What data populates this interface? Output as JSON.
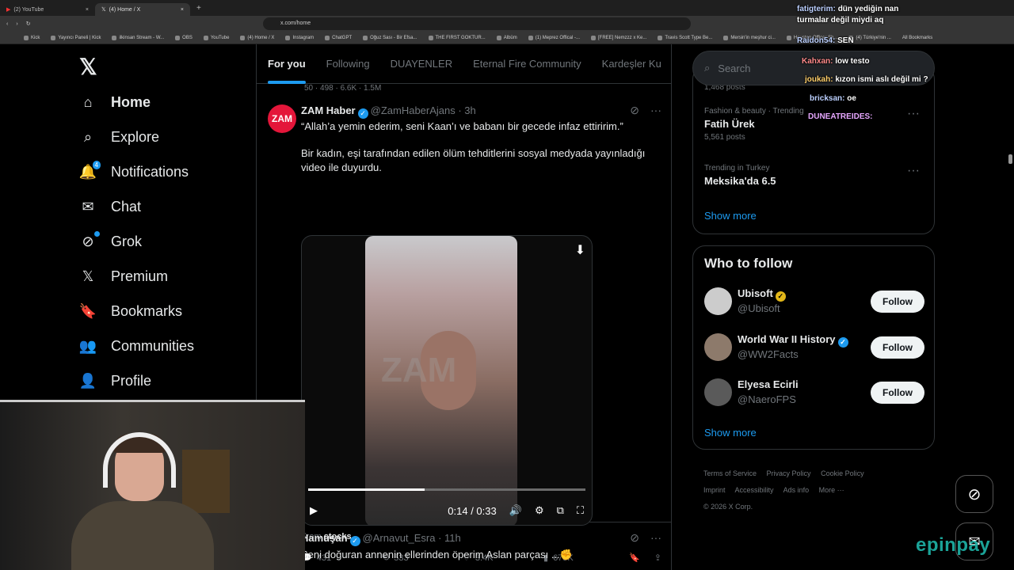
{
  "browser": {
    "tabs": [
      {
        "label": "(2) YouTube",
        "close": "×"
      },
      {
        "label": "(4) Home / X",
        "close": "×"
      }
    ],
    "new_tab": "+",
    "url": "x.com/home",
    "bookmarks": [
      "Kick",
      "Yayıncı Paneli | Kick",
      "ilkinsan Stream - W...",
      "OBS",
      "YouTube",
      "(4) Home / X",
      "Instagram",
      "ChatGPT",
      "Oğuz Sası - Bir Efsa...",
      "THE FIRST GOKTUR...",
      "Albüm",
      "(1) Meprez Offical -...",
      "[FREE] Nemzzz x Ke...",
      "Travis Scott Type Be...",
      "Mersin'in meşhur ci...",
      "Houston Officer Sh...",
      "(4) Türkiye'nin ..."
    ],
    "all_bookmarks": "All Bookmarks"
  },
  "nav": {
    "logo": "𝕏",
    "items": [
      {
        "label": "Home",
        "icon": "home-icon",
        "glyph": "⌂"
      },
      {
        "label": "Explore",
        "icon": "search-icon",
        "glyph": "⌕"
      },
      {
        "label": "Notifications",
        "icon": "bell-icon",
        "glyph": "🔔",
        "badge": "4"
      },
      {
        "label": "Chat",
        "icon": "mail-icon",
        "glyph": "✉"
      },
      {
        "label": "Grok",
        "icon": "grok-icon",
        "glyph": "⊘"
      },
      {
        "label": "Premium",
        "icon": "x-icon",
        "glyph": "𝕏"
      },
      {
        "label": "Bookmarks",
        "icon": "bookmark-icon",
        "glyph": "🔖"
      },
      {
        "label": "Communities",
        "icon": "communities-icon",
        "glyph": "👥"
      },
      {
        "label": "Profile",
        "icon": "person-icon",
        "glyph": "👤"
      }
    ]
  },
  "feed": {
    "tabs": [
      "For you",
      "Following",
      "DUAYENLER",
      "Eternal Fire Community",
      "Kardeşler Ku"
    ],
    "prev_stats": "50    · 498    · 6.6K    · 1.5M",
    "tweet1": {
      "avatar": "ZAM",
      "name": "ZAM Haber",
      "handle": "@ZamHaberAjans · 3h",
      "line1": "“Allah’a yemin ederim, seni Kaan’ı ve babanı bir gecede infaz ettiririm.”",
      "line2": "Bir kadın, eşi tarafından edilen ölüm tehditlerini sosyal medyada yayınladığı video ile duyurdu.",
      "video": {
        "watermark": "ZAM",
        "time": "0:14 / 0:33",
        "progress": 0.42
      },
      "from_label": "From",
      "from_source": "stocks",
      "replies": "431",
      "reposts": "533",
      "likes": "3.4K",
      "views": "675K"
    },
    "tweet2": {
      "name": "Hamuşan",
      "handle": "@Arnavut_Esra · 11h",
      "text": "Seni doğuran annenin ellerinden öperim Aslan parçası ...✊"
    }
  },
  "right": {
    "search_placeholder": "Search",
    "trends": [
      {
        "category": "",
        "name": "",
        "count": "1,468 posts"
      },
      {
        "category": "Fashion & beauty · Trending",
        "name": "Fatih Ürek",
        "count": "5,561 posts"
      },
      {
        "category": "Trending in Turkey",
        "name": "Meksika'da 6.5",
        "count": ""
      }
    ],
    "show_more": "Show more",
    "who_to_follow": "Who to follow",
    "follow": [
      {
        "name": "Ubisoft",
        "handle": "@Ubisoft",
        "button": "Follow",
        "badge": "gold"
      },
      {
        "name": "World War II History",
        "handle": "@WW2Facts",
        "button": "Follow",
        "badge": "blue"
      },
      {
        "name": "Elyesa Ecirli",
        "handle": "@NaeroFPS",
        "button": "Follow",
        "badge": ""
      }
    ],
    "footer": [
      "Terms of Service",
      "Privacy Policy",
      "Cookie Policy",
      "Imprint",
      "Accessibility",
      "Ads info",
      "More ···",
      "© 2026 X Corp."
    ]
  },
  "stream_chat": [
    {
      "user": "fatigterim:",
      "msg": "dün yediğin nan"
    },
    {
      "user": "",
      "msg": "turmalar değil miydi aq"
    },
    {
      "user": "Raidon54:",
      "msg": "SEN"
    },
    {
      "user": "Kahxan:",
      "msg": "low testo"
    },
    {
      "user": "joukah:",
      "msg": "kızon ismi aslı değil mi ?"
    },
    {
      "user": "bricksan:",
      "msg": "oe"
    },
    {
      "user": "DUNEATREIDES:",
      "msg": ""
    }
  ],
  "overlay": {
    "brand": "epinpay"
  },
  "colors": {
    "accent": "#1d9bf0",
    "background": "#000000",
    "border": "#2f3336"
  }
}
